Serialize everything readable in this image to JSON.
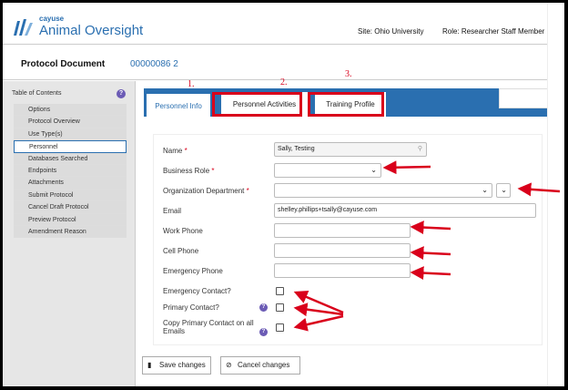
{
  "header": {
    "logo_small": "cayuse",
    "logo_main": "Animal Oversight",
    "site": "Site: Ohio University",
    "role": "Role: Researcher Staff Member"
  },
  "protocol": {
    "title": "Protocol Document",
    "number": "00000086 2"
  },
  "sidebar": {
    "title": "Table of Contents",
    "items": [
      "Options",
      "Protocol Overview",
      "Use Type(s)",
      "Personnel",
      "Databases Searched",
      "Endpoints",
      "Attachments",
      "Submit Protocol",
      "Cancel Draft Protocol",
      "Preview Protocol",
      "Amendment Reason"
    ],
    "active_index": 3
  },
  "tabs": {
    "personnel_info": "Personnel Info",
    "personnel_activities": "Personnel Activities",
    "training_profile": "Training Profile"
  },
  "annotations": {
    "n1": "1.",
    "n2": "2.",
    "n3": "3."
  },
  "form": {
    "name_label": "Name",
    "name_value": "Sally, Testing",
    "business_role_label": "Business Role",
    "org_dept_label": "Organization Department",
    "email_label": "Email",
    "email_value": "shelley.phillips+tsally@cayuse.com",
    "work_phone_label": "Work Phone",
    "cell_phone_label": "Cell Phone",
    "emergency_phone_label": "Emergency Phone",
    "emergency_contact_label": "Emergency Contact?",
    "primary_contact_label": "Primary Contact?",
    "copy_primary_label_1": "Copy Primary Contact on all",
    "copy_primary_label_2": "Emails"
  },
  "buttons": {
    "save": "Save changes",
    "cancel": "Cancel changes"
  },
  "colors": {
    "accent": "#2a6fb0",
    "annotation": "#d9001b",
    "help": "#6b5bb5"
  }
}
